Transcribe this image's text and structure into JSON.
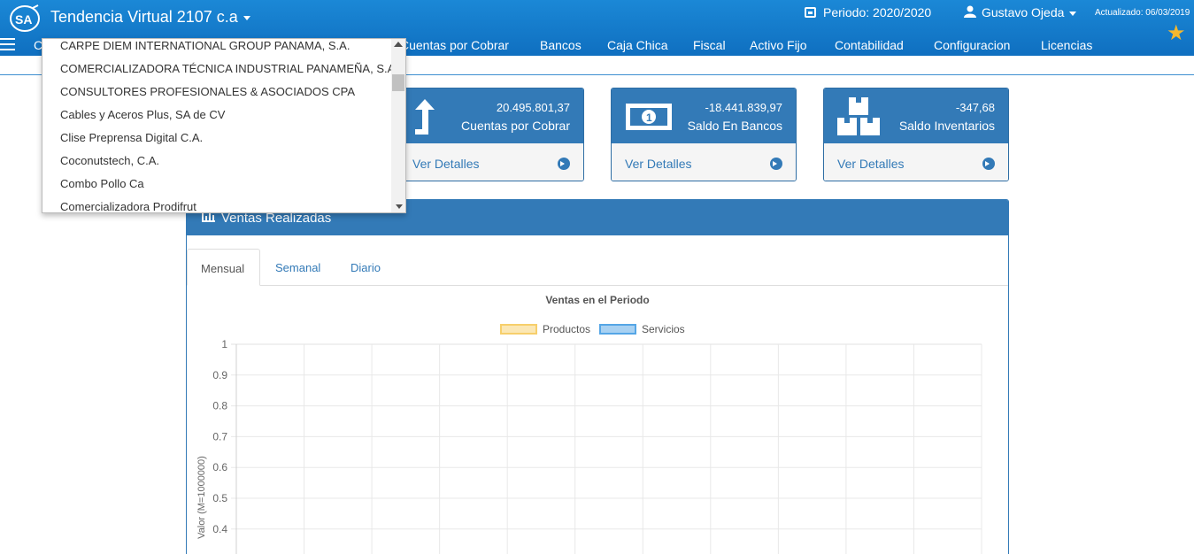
{
  "header": {
    "company": "Tendencia Virtual 2107 c.a",
    "periodo": "Periodo: 2020/2020",
    "user": "Gustavo Ojeda",
    "actualizado": "Actualizado: 06/03/2019"
  },
  "nav": [
    {
      "label": "Cuentas por Cobrar"
    },
    {
      "label": "Bancos"
    },
    {
      "label": "Caja Chica"
    },
    {
      "label": "Fiscal"
    },
    {
      "label": "Activo Fijo"
    },
    {
      "label": "Contabilidad"
    },
    {
      "label": "Configuracion"
    },
    {
      "label": "Licencias"
    }
  ],
  "nav_partial_left": "C",
  "cards": [
    {
      "value": "20.495.801,37",
      "label": "Cuentas por Cobrar",
      "link": "Ver Detalles",
      "icon": "arrow-up-icon"
    },
    {
      "value": "-18.441.839,97",
      "label": "Saldo En Bancos",
      "link": "Ver Detalles",
      "icon": "money-icon"
    },
    {
      "value": "-347,68",
      "label": "Saldo Inventarios",
      "link": "Ver Detalles",
      "icon": "boxes-icon"
    }
  ],
  "panel": {
    "title": "Ventas Realizadas",
    "tabs": [
      "Mensual",
      "Semanal",
      "Diario"
    ]
  },
  "company_dropdown": {
    "items": [
      "CARPE DIEM INTERNATIONAL GROUP PANAMA, S.A.",
      "COMERCIALIZADORA TÉCNICA INDUSTRIAL PANAMEÑA, S.A",
      "CONSULTORES PROFESIONALES & ASOCIADOS CPA",
      "Cables y Aceros Plus, SA de CV",
      "Clise Preprensa Digital C.A.",
      "Coconutstech, C.A.",
      "Combo Pollo Ca",
      "Comercializadora Prodifrut"
    ]
  },
  "chart_data": {
    "type": "bar",
    "title": "Ventas en el Periodo",
    "ylabel": "Valor (M=1000000)",
    "xlabel": "",
    "series": [
      {
        "name": "Productos",
        "values": [],
        "color": "#f7cf6b"
      },
      {
        "name": "Servicios",
        "values": [],
        "color": "#55a6e6"
      }
    ],
    "yticks": [
      "1",
      "0.9",
      "0.8",
      "0.7",
      "0.6",
      "0.5",
      "0.4"
    ],
    "ylim_visible": [
      0.4,
      1
    ],
    "grid": true,
    "legend": "top-center"
  },
  "colors": {
    "primary": "#337ab7",
    "header": "#1580cf",
    "star": "#f5b82e"
  }
}
